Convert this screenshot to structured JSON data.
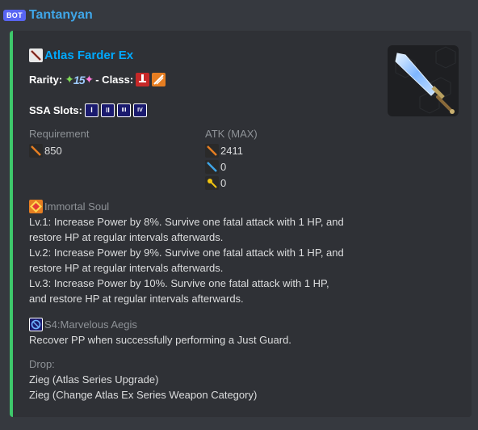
{
  "header": {
    "bot_badge": "BOT",
    "bot_name": "Tantanyan"
  },
  "embed": {
    "accent_color": "#3ec86b",
    "title": "Atlas Farder Ex",
    "title_icon": "sword-class-icon",
    "rarity_label": "Rarity:",
    "rarity_value": "15",
    "class_label": "- Class:",
    "ssa_label": "SSA Slots:",
    "ssa_slots": [
      "I",
      "II",
      "III",
      "IV"
    ],
    "requirement": {
      "label": "Requirement",
      "value": "850"
    },
    "atk": {
      "label": "ATK (MAX)",
      "values": [
        "2411",
        "0",
        "0"
      ]
    },
    "potential": {
      "name": "Immortal Soul",
      "lines": [
        "Lv.1: Increase Power by 8%. Survive one fatal attack with 1 HP, and",
        "restore HP at regular intervals afterwards.",
        "Lv.2: Increase Power by 9%. Survive one fatal attack with 1 HP, and",
        "restore HP at regular intervals afterwards.",
        "Lv.3: Increase Power by 10%. Survive one fatal attack with 1 HP,",
        "and restore HP at regular intervals afterwards."
      ]
    },
    "ssa": {
      "name": "S4:Marvelous Aegis",
      "desc": "Recover PP when successfully performing a Just Guard."
    },
    "drop": {
      "label": "Drop:",
      "lines": [
        "Zieg (Atlas Series Upgrade)",
        "Zieg (Change Atlas Ex Series Weapon Category)"
      ]
    }
  }
}
